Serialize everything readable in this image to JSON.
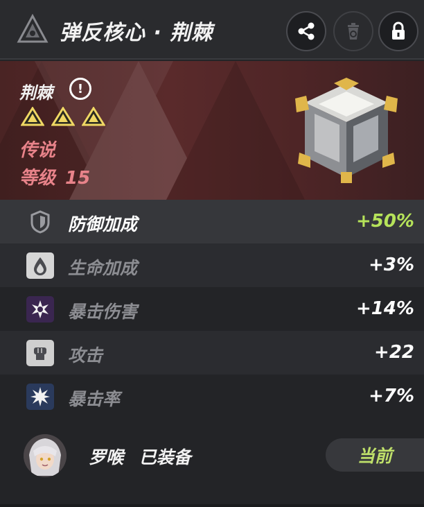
{
  "header": {
    "title": "弹反核心 · 荆棘"
  },
  "item": {
    "name": "荆棘",
    "rarity": "传说",
    "level_label": "等级",
    "level_value": "15",
    "stars": 3
  },
  "stats": [
    {
      "label": "防御加成",
      "value": "+50%",
      "icon": "shield-icon"
    },
    {
      "label": "生命加成",
      "value": "+3%",
      "icon": "drop-icon"
    },
    {
      "label": "暴击伤害",
      "value": "+14%",
      "icon": "burst-icon"
    },
    {
      "label": "攻击",
      "value": "+22",
      "icon": "fist-icon"
    },
    {
      "label": "暴击率",
      "value": "+7%",
      "icon": "star-burst-icon"
    }
  ],
  "equip": {
    "character": "罗喉",
    "status": "已装备",
    "current_label": "当前"
  },
  "colors": {
    "accent_green": "#b6e35a",
    "rarity_red": "#e8838a",
    "banner": "#5a2a2b"
  }
}
